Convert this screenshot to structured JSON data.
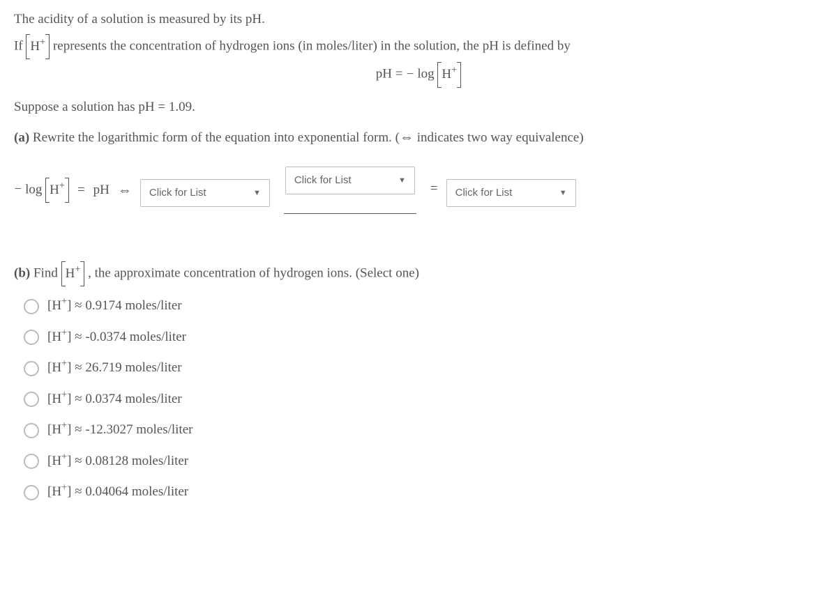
{
  "intro": {
    "line1": "The acidity of a solution is measured by its pH.",
    "if": "If ",
    "represents": " represents the concentration of hydrogen ions (in moles/liter) in the solution, the pH is defined by",
    "pH_lhs": "pH",
    "eq": " = ",
    "minus": "−",
    "log": " log ",
    "H": "H",
    "plus": "+"
  },
  "suppose": "Suppose a solution has pH = 1.09.",
  "parta": {
    "label": "(a)",
    "text": " Rewrite the logarithmic form of the equation into exponential form. (",
    "arrow": "⇔",
    "text2": " indicates two way equivalence)"
  },
  "eqrow": {
    "minus": "−",
    "log": " log ",
    "H": "H",
    "plus": "+",
    "equals1": "=",
    "pH": "pH",
    "iff": "⇔",
    "equals2": "="
  },
  "dropdown_placeholder": "Click for List",
  "partb": {
    "label": "(b)",
    "find": " Find ",
    "H": "H",
    "plus": "+",
    "rest": " , the approximate concentration of hydrogen ions. (Select one)"
  },
  "options": [
    {
      "prefix": "[H",
      "sup": "+",
      "mid": "] ≈ ",
      "val": "0.9174 moles/liter"
    },
    {
      "prefix": "[H",
      "sup": "+",
      "mid": "] ≈ ",
      "val": "-0.0374 moles/liter"
    },
    {
      "prefix": "[H",
      "sup": "+",
      "mid": "] ≈ ",
      "val": "26.719 moles/liter"
    },
    {
      "prefix": "[H",
      "sup": "+",
      "mid": "] ≈ ",
      "val": "0.0374 moles/liter"
    },
    {
      "prefix": "[H",
      "sup": "+",
      "mid": "] ≈ ",
      "val": "-12.3027 moles/liter"
    },
    {
      "prefix": "[H",
      "sup": "+",
      "mid": "] ≈ ",
      "val": "0.08128 moles/liter"
    },
    {
      "prefix": "[H",
      "sup": "+",
      "mid": "] ≈ ",
      "val": "0.04064 moles/liter"
    }
  ]
}
